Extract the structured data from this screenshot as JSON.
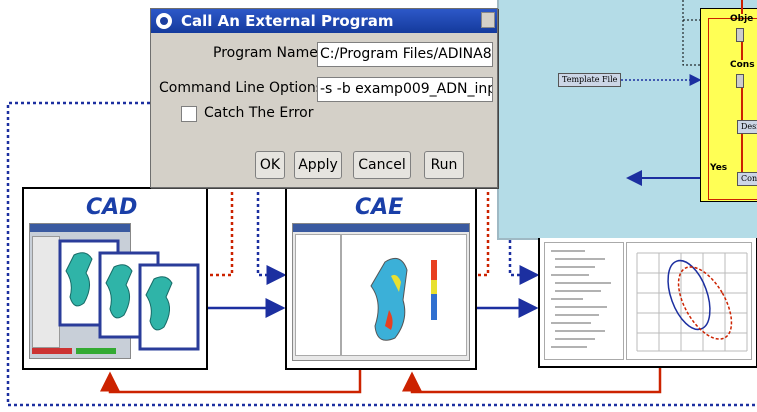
{
  "dialog": {
    "title": "Call An External Program",
    "program_name_label": "Program Name",
    "program_name_value": "C:/Program Files/ADINA8",
    "cmd_options_label": "Command Line Options",
    "cmd_options_value": "-s -b examp009_ADN_inp",
    "catch_error_label": "Catch The Error",
    "catch_error_checked": false,
    "buttons": {
      "ok": "OK",
      "apply": "Apply",
      "cancel": "Cancel",
      "run": "Run"
    }
  },
  "diagram": {
    "template_file": "Template File",
    "obj_label": "Obje",
    "cons_label": "Cons",
    "desi_label": "Desig",
    "conv_label": "Conv",
    "yes_label": "Yes",
    "cad_title": "CAD",
    "cae_title": "CAE"
  },
  "colors": {
    "title_bar": "#143a9c",
    "panel_blue": "#1a3fa8",
    "arrow_red": "#cc2200",
    "dotted_blue": "#1c2fa0",
    "right_bg": "#b4dce7",
    "flow_yellow": "#ffff55"
  }
}
